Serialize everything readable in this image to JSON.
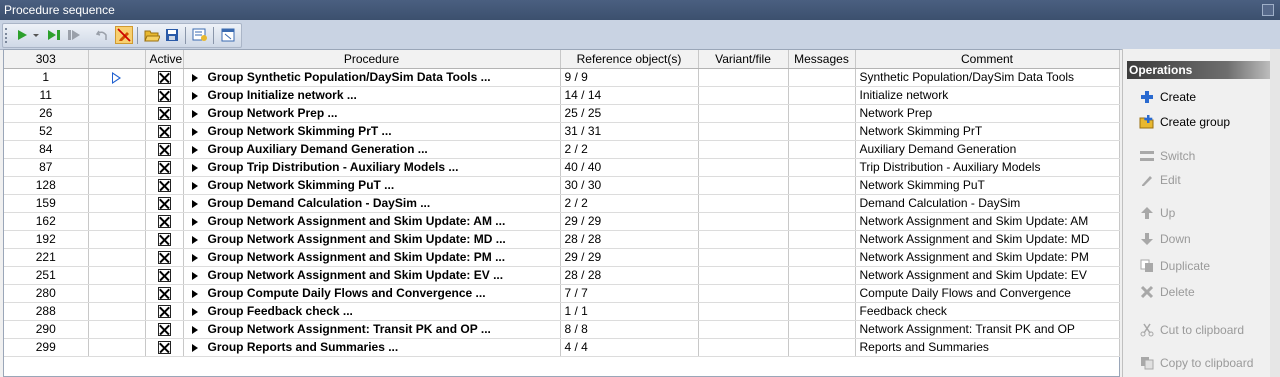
{
  "window": {
    "title": "Procedure sequence"
  },
  "toolbar": {
    "buttons": [
      {
        "icon": "run-icon",
        "color": "#2ca02c"
      },
      {
        "icon": "run-dropdown-icon",
        "color": "#555555"
      },
      {
        "icon": "run-to-icon",
        "color": "#2ca02c"
      },
      {
        "icon": "step-icon",
        "color": "#9aa0aa"
      },
      {
        "icon": "undo-icon",
        "color": "#9aa0aa"
      },
      {
        "icon": "no-edit-icon",
        "color": "#d05000"
      },
      {
        "icon": "open-folder-icon",
        "color": "#e8b830"
      },
      {
        "icon": "save-icon",
        "color": "#2a5aa8"
      },
      {
        "icon": "properties-icon",
        "color": "#3a6ab0"
      },
      {
        "icon": "window-icon",
        "color": "#3a6ab0"
      }
    ]
  },
  "grid": {
    "headers": {
      "number": "303",
      "active": "Active",
      "procedure": "Procedure",
      "reference": "Reference object(s)",
      "variant": "Variant/file",
      "messages": "Messages",
      "comment": "Comment"
    },
    "rows": [
      {
        "number": "1",
        "current": true,
        "procedure": "Group Synthetic Population/DaySim Data Tools ...",
        "reference": "9 / 9",
        "comment": "Synthetic Population/DaySim Data Tools"
      },
      {
        "number": "11",
        "current": false,
        "procedure": "Group Initialize network ...",
        "reference": "14 / 14",
        "comment": "Initialize network"
      },
      {
        "number": "26",
        "current": false,
        "procedure": "Group Network Prep ...",
        "reference": "25 / 25",
        "comment": "Network Prep"
      },
      {
        "number": "52",
        "current": false,
        "procedure": "Group Network Skimming PrT ...",
        "reference": "31 / 31",
        "comment": "Network Skimming PrT"
      },
      {
        "number": "84",
        "current": false,
        "procedure": "Group Auxiliary Demand Generation ...",
        "reference": "2 / 2",
        "comment": "Auxiliary Demand Generation"
      },
      {
        "number": "87",
        "current": false,
        "procedure": "Group Trip Distribution - Auxiliary Models ...",
        "reference": "40 / 40",
        "comment": "Trip Distribution - Auxiliary Models"
      },
      {
        "number": "128",
        "current": false,
        "procedure": "Group Network Skimming PuT ...",
        "reference": "30 / 30",
        "comment": "Network Skimming PuT"
      },
      {
        "number": "159",
        "current": false,
        "procedure": "Group Demand Calculation - DaySim ...",
        "reference": "2 / 2",
        "comment": "Demand Calculation - DaySim"
      },
      {
        "number": "162",
        "current": false,
        "procedure": "Group Network Assignment and Skim Update: AM ...",
        "reference": "29 / 29",
        "comment": "Network Assignment and Skim Update: AM"
      },
      {
        "number": "192",
        "current": false,
        "procedure": "Group Network Assignment and Skim Update: MD ...",
        "reference": "28 / 28",
        "comment": "Network Assignment and Skim Update: MD"
      },
      {
        "number": "221",
        "current": false,
        "procedure": "Group Network Assignment and Skim Update: PM ...",
        "reference": "29 / 29",
        "comment": "Network Assignment and Skim Update: PM"
      },
      {
        "number": "251",
        "current": false,
        "procedure": "Group Network Assignment and Skim Update: EV ...",
        "reference": "28 / 28",
        "comment": "Network Assignment and Skim Update: EV"
      },
      {
        "number": "280",
        "current": false,
        "procedure": "Group Compute Daily Flows and Convergence ...",
        "reference": "7 / 7",
        "comment": "Compute Daily Flows and Convergence"
      },
      {
        "number": "288",
        "current": false,
        "procedure": "Group Feedback check ...",
        "reference": "1 / 1",
        "comment": "Feedback check"
      },
      {
        "number": "290",
        "current": false,
        "procedure": "Group Network Assignment: Transit PK and OP ...",
        "reference": "8 / 8",
        "comment": "Network Assignment: Transit PK and OP"
      },
      {
        "number": "299",
        "current": false,
        "procedure": "Group Reports and Summaries ...",
        "reference": "4 / 4",
        "comment": "Reports and Summaries"
      }
    ]
  },
  "operations": {
    "title": "Operations",
    "items": [
      {
        "label": "Create",
        "icon": "plus-icon",
        "enabled": true
      },
      {
        "label": "Create group",
        "icon": "create-group-icon",
        "enabled": true
      },
      {
        "label": "Switch",
        "icon": "switch-icon",
        "enabled": false
      },
      {
        "label": "Edit",
        "icon": "pencil-icon",
        "enabled": false
      },
      {
        "label": "Up",
        "icon": "arrow-up-icon",
        "enabled": false
      },
      {
        "label": "Down",
        "icon": "arrow-down-icon",
        "enabled": false
      },
      {
        "label": "Duplicate",
        "icon": "duplicate-icon",
        "enabled": false
      },
      {
        "label": "Delete",
        "icon": "delete-icon",
        "enabled": false
      },
      {
        "label": "Cut to clipboard",
        "icon": "scissors-icon",
        "enabled": false
      },
      {
        "label": "Copy to clipboard",
        "icon": "copy-icon",
        "enabled": false
      }
    ]
  }
}
